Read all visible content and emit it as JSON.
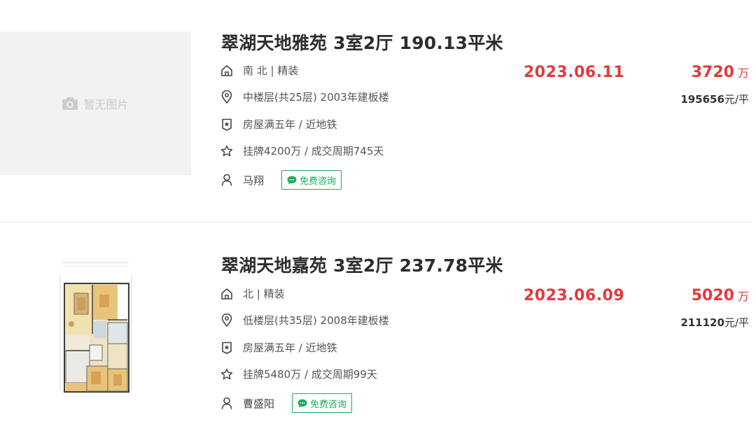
{
  "listings": [
    {
      "thumbnail_text": "暂无图片",
      "title": "翠湖天地雅苑 3室2厅 190.13平米",
      "orientation_decoration": "南 北 | 精装",
      "floor_info": "中楼层(共25层) 2003年建板楼",
      "tags": "房屋满五年 / 近地铁",
      "listing_info": "挂牌4200万 / 成交周期745天",
      "agent": "马翔",
      "consult_label": "免费咨询",
      "deal_date": "2023.06.11",
      "total_price": "3720",
      "total_unit": "万",
      "unit_price_value": "195656",
      "unit_price_suffix": "元/平"
    },
    {
      "thumbnail_text": "",
      "title": "翠湖天地嘉苑 3室2厅 237.78平米",
      "orientation_decoration": "北 | 精装",
      "floor_info": "低楼层(共35层) 2008年建板楼",
      "tags": "房屋满五年 / 近地铁",
      "listing_info": "挂牌5480万 / 成交周期99天",
      "agent": "曹盛阳",
      "consult_label": "免费咨询",
      "deal_date": "2023.06.09",
      "total_price": "5020",
      "total_unit": "万",
      "unit_price_value": "211120",
      "unit_price_suffix": "元/平"
    }
  ],
  "colors": {
    "accent_red": "#e4393c",
    "consult_green": "#1faa5b"
  }
}
